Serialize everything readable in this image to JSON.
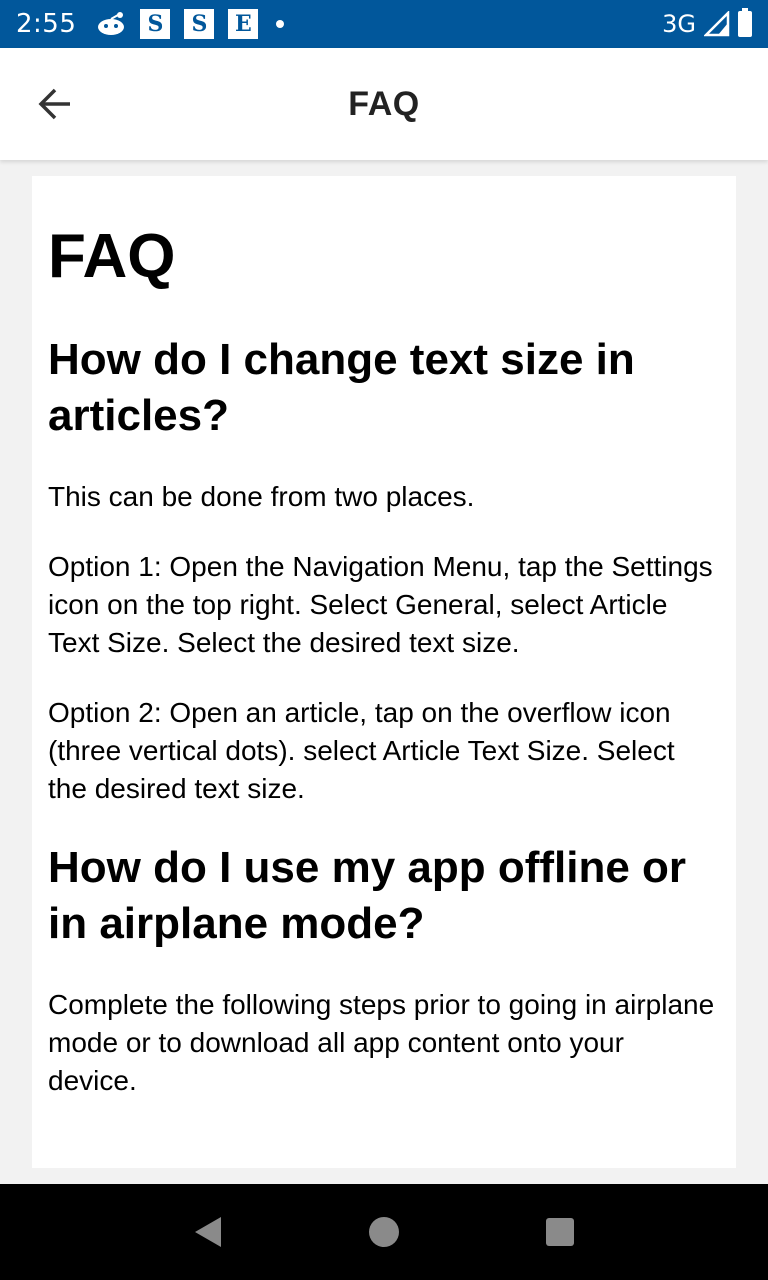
{
  "status_bar": {
    "time": "2:55",
    "notification_badges": [
      "S",
      "S",
      "E"
    ],
    "network": "3G",
    "icons": [
      "reddit-icon",
      "dot-icon",
      "signal-icon",
      "battery-icon"
    ]
  },
  "app_bar": {
    "title": "FAQ",
    "back_icon": "arrow-back-icon"
  },
  "content": {
    "title": "FAQ",
    "questions": [
      {
        "question": "How do I change text size in articles?",
        "paragraphs": [
          "This can be done from two places.",
          "Option 1: Open the Navigation Menu, tap the Settings icon on the top right. Select General, select Article Text Size. Select the desired text size.",
          "Option 2: Open an article, tap on the overflow icon (three vertical dots). select Article Text Size. Select the desired text size."
        ]
      },
      {
        "question": "How do I use my app offline or in airplane mode?",
        "paragraphs": [
          "Complete the following steps prior to going in airplane mode or to download all app content onto your device."
        ]
      }
    ]
  },
  "nav_bar": {
    "buttons": [
      "back-triangle-icon",
      "home-circle-icon",
      "recents-square-icon"
    ]
  },
  "colors": {
    "status_bar": "#01579b",
    "background": "#f2f2f2",
    "card": "#ffffff",
    "nav_bar": "#000000"
  }
}
